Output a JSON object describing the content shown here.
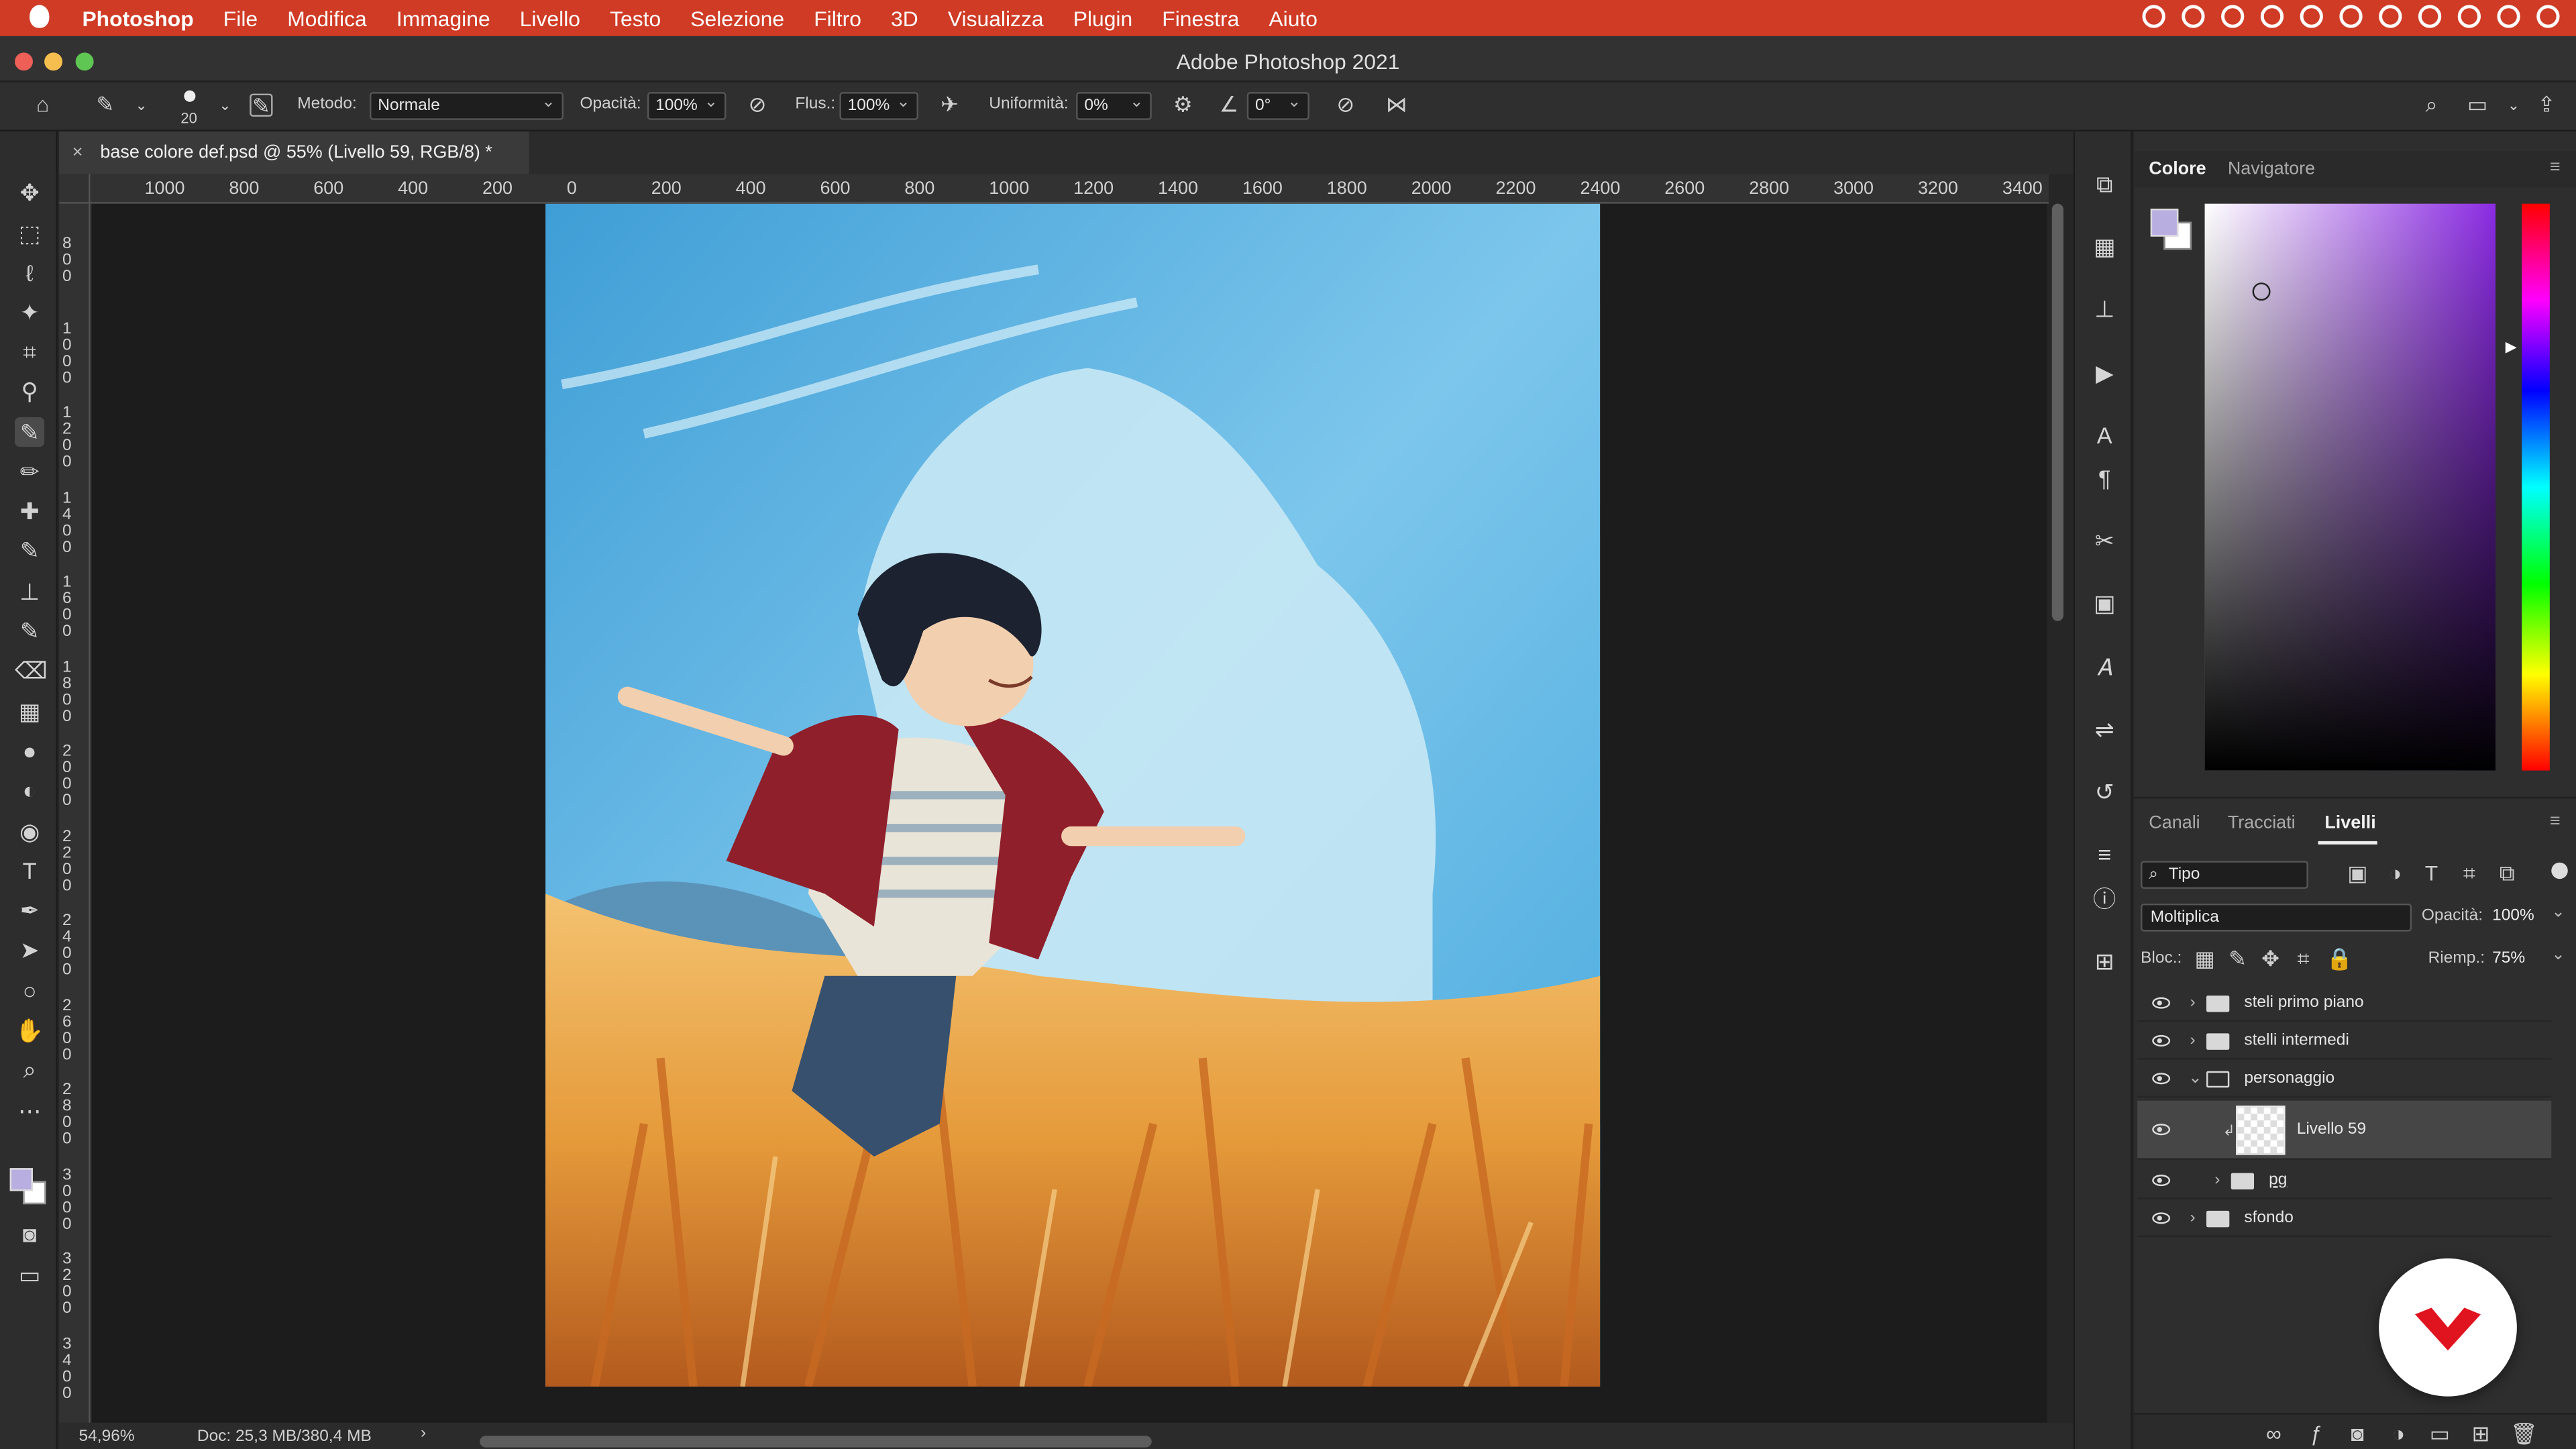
{
  "menubar": {
    "app": "Photoshop",
    "items": [
      "File",
      "Modifica",
      "Immagine",
      "Livello",
      "Testo",
      "Selezione",
      "Filtro",
      "3D",
      "Visualizza",
      "Plugin",
      "Finestra",
      "Aiuto"
    ]
  },
  "window": {
    "title": "Adobe Photoshop 2021"
  },
  "options": {
    "brush_size": "20",
    "method_label": "Metodo:",
    "method_value": "Normale",
    "opacity_label": "Opacità:",
    "opacity_value": "100%",
    "flow_label": "Flus.:",
    "flow_value": "100%",
    "smooth_label": "Uniformità:",
    "smooth_value": "0%",
    "angle_value": "0°"
  },
  "document": {
    "tab_title": "base colore def.psd @ 55% (Livello 59, RGB/8) *",
    "zoom": "54,96%",
    "doc_info": "Doc: 25,3 MB/380,4 MB"
  },
  "ruler": {
    "h_labels": [
      "1000",
      "800",
      "600",
      "400",
      "200",
      "0",
      "200",
      "400",
      "600",
      "800",
      "1000",
      "1200",
      "1400",
      "1600",
      "1800",
      "2000",
      "2200",
      "2400",
      "2600",
      "2800",
      "3000",
      "3200",
      "3400"
    ],
    "v_labels": [
      "800",
      "1000",
      "1200",
      "1400",
      "1600",
      "1800",
      "2000",
      "2200",
      "2400",
      "2600",
      "2800",
      "3000",
      "3200",
      "3400"
    ]
  },
  "color_panel": {
    "tabs": [
      "Colore",
      "Navigatore"
    ],
    "fg_color": "#b9aee0",
    "bg_color": "#ffffff"
  },
  "layers_panel": {
    "tabs": [
      "Canali",
      "Tracciati",
      "Livelli"
    ],
    "filter": "Tipo",
    "blend": "Moltiplica",
    "opacity_label": "Opacità:",
    "opacity": "100%",
    "lock_label": "Bloc.:",
    "fill_label": "Riemp.:",
    "fill": "75%",
    "layers": [
      {
        "name": "steli primo piano",
        "type": "group",
        "indent": 0,
        "open": false
      },
      {
        "name": "stelli intermedi",
        "type": "group",
        "indent": 0,
        "open": false
      },
      {
        "name": "personaggio",
        "type": "group",
        "indent": 0,
        "open": true
      },
      {
        "name": "Livello 59",
        "type": "layer",
        "indent": 1,
        "selected": true
      },
      {
        "name": "pg",
        "type": "group",
        "indent": 1,
        "open": false
      },
      {
        "name": "sfondo",
        "type": "group",
        "indent": 0,
        "open": false
      }
    ]
  },
  "colors": {
    "accent": "#cf3b25",
    "panel": "#2e2e2e",
    "selected": "#464646"
  }
}
